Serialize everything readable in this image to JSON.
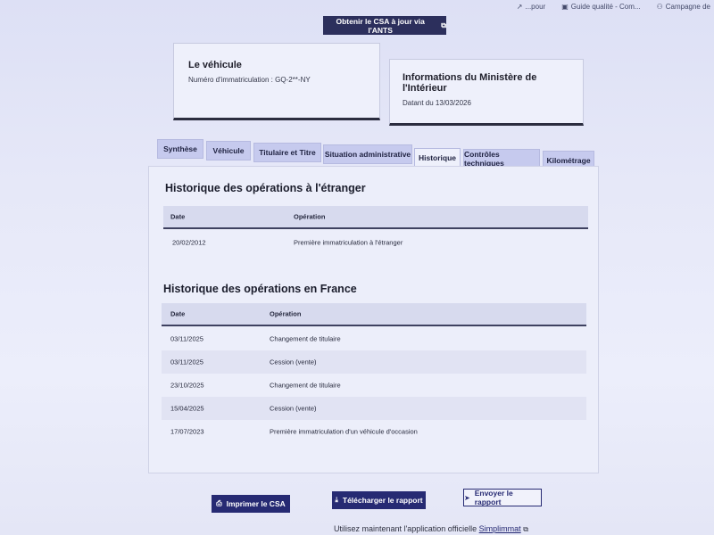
{
  "topnav": {
    "items": [
      {
        "label": "...pour",
        "icon": "external-link-icon"
      },
      {
        "label": "Guide qualité - Com...",
        "icon": "document-icon"
      },
      {
        "label": "Campagne de",
        "icon": "user-icon"
      }
    ]
  },
  "header": {
    "ants_button_label": "Obtenir le CSA à jour via l'ANTS",
    "ants_button_icon": "external-link-icon"
  },
  "vehicle_card": {
    "title": "Le véhicule",
    "plate_line": "Numéro d'immatriculation : GQ-2**-NY"
  },
  "ministry_card": {
    "title": "Informations du Ministère de l'Intérieur",
    "date_line": "Datant du 13/03/2026"
  },
  "tabs": [
    {
      "label": "Synthèse"
    },
    {
      "label": "Véhicule"
    },
    {
      "label": "Titulaire et Titre"
    },
    {
      "label": "Situation administrative"
    },
    {
      "label": "Historique"
    },
    {
      "label": "Contrôles techniques"
    },
    {
      "label": "Kilométrage"
    }
  ],
  "active_tab": "Historique",
  "foreign": {
    "title": "Historique des opérations à l'étranger",
    "columns": [
      "Date",
      "Opération"
    ],
    "rows": [
      {
        "date": "20/02/2012",
        "operation": "Première immatriculation à l'étranger"
      }
    ]
  },
  "france": {
    "title": "Historique des opérations en France",
    "columns": [
      "Date",
      "Opération"
    ],
    "rows": [
      {
        "date": "03/11/2025",
        "operation": "Changement de titulaire"
      },
      {
        "date": "03/11/2025",
        "operation": "Cession (vente)"
      },
      {
        "date": "23/10/2025",
        "operation": "Changement de titulaire"
      },
      {
        "date": "15/04/2025",
        "operation": "Cession (vente)"
      },
      {
        "date": "17/07/2023",
        "operation": "Première immatriculation d'un véhicule d'occasion"
      }
    ]
  },
  "actions": {
    "print_label": "Imprimer le CSA",
    "download_label": "Télécharger le rapport",
    "send_label": "Envoyer le rapport"
  },
  "footer": {
    "note_prefix": "Utilisez maintenant l'application officielle",
    "app_link": "Simplimmat"
  },
  "colors": {
    "primary": "#262a73",
    "tab_bg": "#c6caee",
    "panel_bg": "#eceefa"
  }
}
